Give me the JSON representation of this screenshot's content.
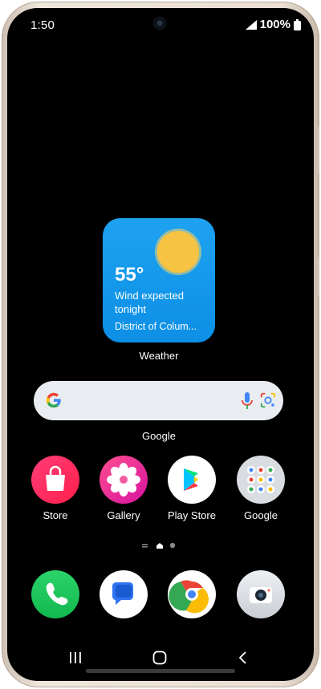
{
  "status_bar": {
    "time": "1:50",
    "battery": "100%"
  },
  "weather_widget": {
    "temperature": "55°",
    "condition": "Wind expected tonight",
    "location": "District of Colum...",
    "label": "Weather"
  },
  "search_widget": {
    "label": "Google"
  },
  "apps_row": [
    {
      "label": "Store"
    },
    {
      "label": "Gallery"
    },
    {
      "label": "Play Store"
    },
    {
      "label": "Google"
    }
  ],
  "dock": [
    {
      "name": "phone-icon"
    },
    {
      "name": "messages-icon"
    },
    {
      "name": "chrome-icon"
    },
    {
      "name": "camera-icon"
    }
  ],
  "colors": {
    "weather_bg": "#0c8fe5",
    "search_bg": "#e9edf1"
  }
}
